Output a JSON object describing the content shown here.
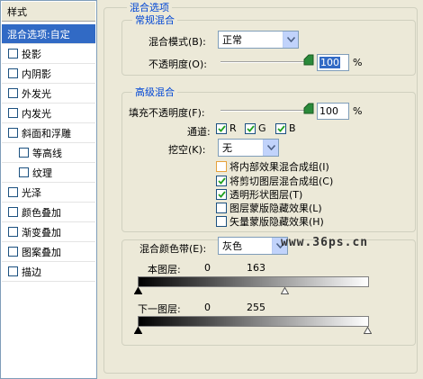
{
  "sidebar": {
    "header": "样式",
    "selected": "混合选项:自定",
    "items": [
      {
        "label": "投影",
        "level": 1
      },
      {
        "label": "内阴影",
        "level": 1
      },
      {
        "label": "外发光",
        "level": 1
      },
      {
        "label": "内发光",
        "level": 1
      },
      {
        "label": "斜面和浮雕",
        "level": 1
      },
      {
        "label": "等高线",
        "level": 2
      },
      {
        "label": "纹理",
        "level": 2
      },
      {
        "label": "光泽",
        "level": 1
      },
      {
        "label": "颜色叠加",
        "level": 1
      },
      {
        "label": "渐变叠加",
        "level": 1
      },
      {
        "label": "图案叠加",
        "level": 1
      },
      {
        "label": "描边",
        "level": 1
      }
    ]
  },
  "blending_options": {
    "title": "混合选项",
    "general": {
      "title": "常规混合",
      "blend_mode_label": "混合模式(B):",
      "blend_mode_value": "正常",
      "opacity_label": "不透明度(O):",
      "opacity_value": "100",
      "opacity_unit": "%",
      "opacity_level": 1.0
    },
    "advanced": {
      "title": "高级混合",
      "fill_opacity_label": "填充不透明度(F):",
      "fill_opacity_value": "100",
      "fill_opacity_unit": "%",
      "fill_opacity_level": 1.0,
      "channels_label": "通道:",
      "channels": [
        {
          "label": "R",
          "checked": true
        },
        {
          "label": "G",
          "checked": true
        },
        {
          "label": "B",
          "checked": true
        }
      ],
      "knockout_label": "挖空(K):",
      "knockout_value": "无",
      "options": [
        {
          "label": "将内部效果混合成组(I)",
          "checked": false
        },
        {
          "label": "将剪切图层混合成组(C)",
          "checked": true
        },
        {
          "label": "透明形状图层(T)",
          "checked": true
        },
        {
          "label": "图层蒙版隐藏效果(L)",
          "checked": false
        },
        {
          "label": "矢量蒙版隐藏效果(H)",
          "checked": false
        }
      ]
    },
    "blend_if": {
      "label": "混合颜色带(E):",
      "value": "灰色",
      "this_layer_label": "本图层:",
      "this_layer_black": "0",
      "this_layer_white": "163",
      "underlying_label": "下一图层:",
      "underlying_black": "0",
      "underlying_white": "255"
    }
  },
  "watermark": "www.36ps.cn",
  "colors": {
    "accent": "#316ac5",
    "group_title": "#0046d5",
    "panel_bg": "#ece9d8"
  },
  "icons": [
    "dropdown-arrow-icon",
    "slider-thumb-icon",
    "checkmark-icon",
    "triangle-stop-icon"
  ]
}
